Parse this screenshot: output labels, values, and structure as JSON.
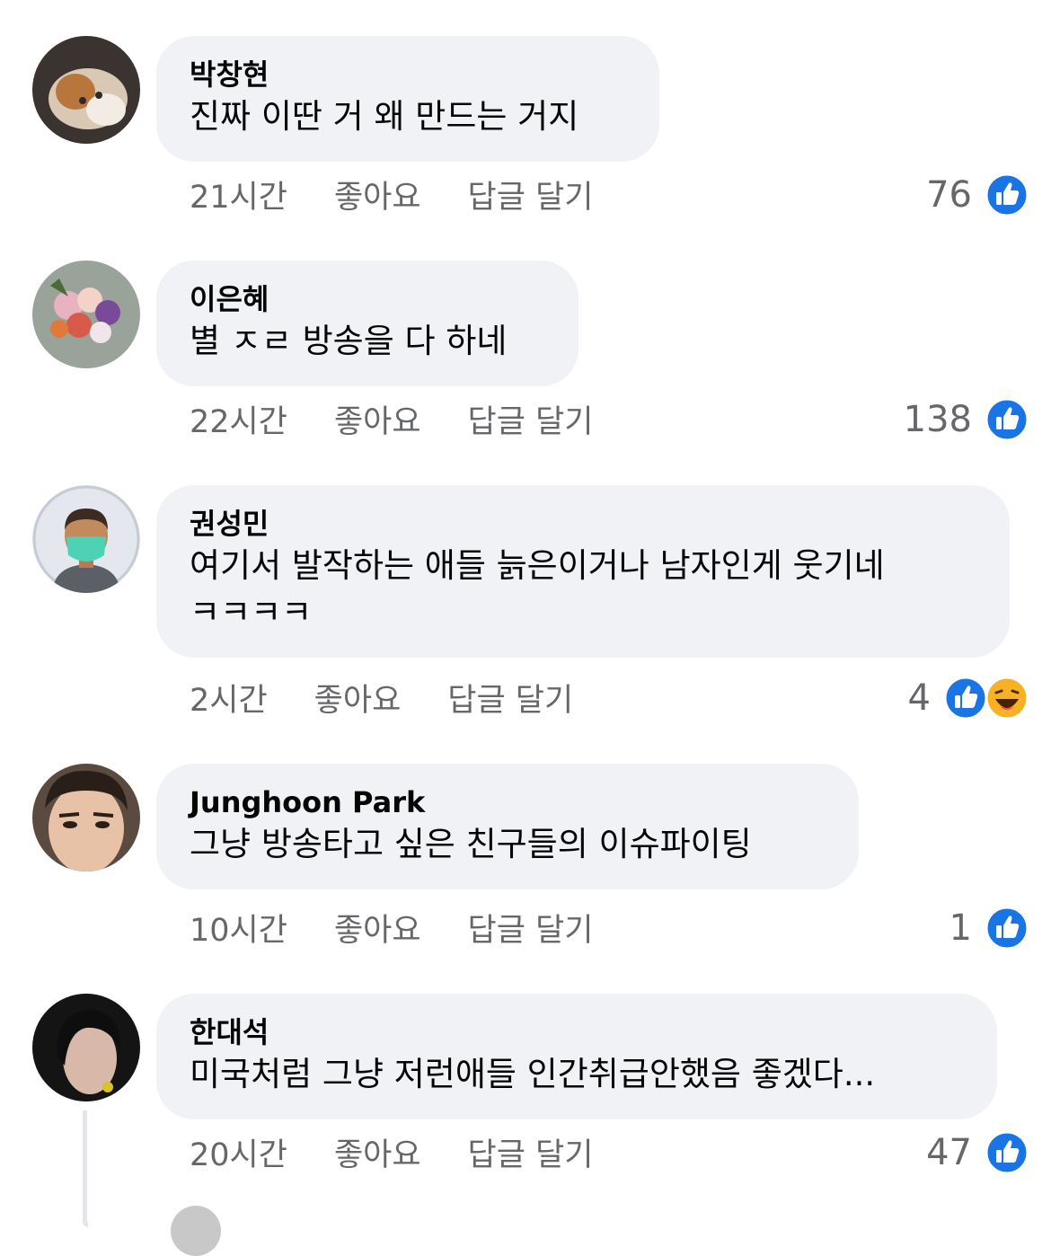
{
  "comments": [
    {
      "author": "박창현",
      "text": [
        "진짜 이딴 거 왜 만드는 거지"
      ],
      "time": "21시간",
      "like": "좋아요",
      "reply": "답글 달기",
      "reactions": "76",
      "reaction_icons": [
        "like-icon"
      ]
    },
    {
      "author": "이은혜",
      "text": [
        "별 ㅈㄹ 방송을 다 하네"
      ],
      "time": "22시간",
      "like": "좋아요",
      "reply": "답글 달기",
      "reactions": "138",
      "reaction_icons": [
        "like-icon"
      ]
    },
    {
      "author": "권성민",
      "text": [
        "여기서 발작하는 애들 늙은이거나 남자인게 웃기네",
        "ㅋㅋㅋㅋ"
      ],
      "time": "2시간",
      "like": "좋아요",
      "reply": "답글 달기",
      "reactions": "4",
      "reaction_icons": [
        "like-icon",
        "haha-icon"
      ]
    },
    {
      "author": "Junghoon Park",
      "text": [
        "그냥 방송타고 싶은 친구들의 이슈파이팅"
      ],
      "time": "10시간",
      "like": "좋아요",
      "reply": "답글 달기",
      "reactions": "1",
      "reaction_icons": [
        "like-icon"
      ]
    },
    {
      "author": "한대석",
      "text": [
        "미국처럼 그냥 저런애들 인간취급안했음 좋겠다..."
      ],
      "time": "20시간",
      "like": "좋아요",
      "reply": "답글 달기",
      "reactions": "47",
      "reaction_icons": [
        "like-icon"
      ]
    }
  ],
  "colors": {
    "bubble": "#f0f2f5",
    "meta": "#65676b",
    "like_blue": "#1b74e4",
    "haha_yellow": "#f7b125"
  }
}
